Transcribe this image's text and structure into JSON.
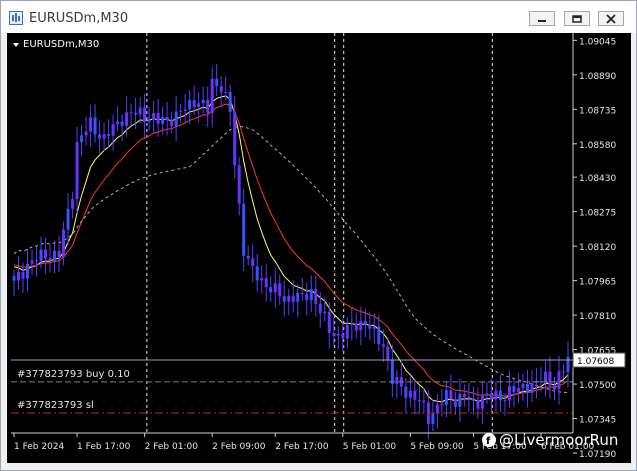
{
  "window": {
    "title": "EURUSDm,M30",
    "buttons": [
      "minimize-icon",
      "restore-icon",
      "close-icon"
    ]
  },
  "chart_header": {
    "label": "EURUSDm,M30"
  },
  "colors": {
    "background": "#000000",
    "candle": "#6633ff",
    "candle_alt": "#3355ff",
    "ema_fast": "#ffff66",
    "ema_mid": "#ff3333",
    "sma_slow": "#b0b0b0",
    "order_line": "#808080",
    "sl_line": "#cc2222",
    "price_tag_bg": "#ffffff"
  },
  "orders": [
    {
      "label": "#377823793 buy 0.10",
      "price": 1.0751,
      "type": "buy"
    },
    {
      "label": "#377823793 sl",
      "price": 1.0737,
      "type": "sl"
    }
  ],
  "current_price": "1.07608",
  "watermark": "@LivermoorRun",
  "chart_data": {
    "type": "candlestick",
    "symbol": "EURUSDm",
    "timeframe": "M30",
    "ylim": [
      1.0728,
      1.0906
    ],
    "y_ticks": [
      "1.09045",
      "1.08890",
      "1.08735",
      "1.08580",
      "1.08430",
      "1.08275",
      "1.08120",
      "1.07965",
      "1.07810",
      "1.07655",
      "1.07500",
      "1.07345",
      "1.07190"
    ],
    "x_ticks": [
      "1 Feb 2024",
      "1 Feb 17:00",
      "2 Feb 01:00",
      "2 Feb 09:00",
      "2 Feb 17:00",
      "5 Feb 01:00",
      "5 Feb 09:00",
      "5 Feb 17:00",
      "6 Feb 01:00"
    ],
    "period_separators": [
      "1 Feb 2024 21:00",
      "2 Feb 2024 19:30",
      "2 Feb 2024 20:30",
      "5 Feb 2024 14:00"
    ],
    "price_path": [
      [
        0,
        1.0795
      ],
      [
        3,
        1.0804
      ],
      [
        7,
        1.0808
      ],
      [
        10,
        1.0808
      ],
      [
        13,
        1.0837
      ],
      [
        14,
        1.0858
      ],
      [
        17,
        1.0867
      ],
      [
        20,
        1.086
      ],
      [
        24,
        1.087
      ],
      [
        28,
        1.0872
      ],
      [
        32,
        1.0868
      ],
      [
        36,
        1.087
      ],
      [
        40,
        1.0878
      ],
      [
        43,
        1.0873
      ],
      [
        44,
        1.0886
      ],
      [
        46,
        1.0884
      ],
      [
        48,
        1.0872
      ],
      [
        49,
        1.0849
      ],
      [
        51,
        1.0811
      ],
      [
        53,
        1.08
      ],
      [
        56,
        1.0795
      ],
      [
        60,
        1.0788
      ],
      [
        62,
        1.079
      ],
      [
        64,
        1.0788
      ],
      [
        66,
        1.0792
      ],
      [
        68,
        1.0783
      ],
      [
        70,
        1.0774
      ],
      [
        72,
        1.0772
      ],
      [
        74,
        1.0774
      ],
      [
        76,
        1.0777
      ],
      [
        78,
        1.0778
      ],
      [
        80,
        1.0772
      ],
      [
        82,
        1.0768
      ],
      [
        84,
        1.0752
      ],
      [
        86,
        1.0748
      ],
      [
        88,
        1.0746
      ],
      [
        90,
        1.0742
      ],
      [
        92,
        1.0735
      ],
      [
        94,
        1.074
      ],
      [
        96,
        1.0744
      ],
      [
        98,
        1.0743
      ],
      [
        100,
        1.0745
      ],
      [
        102,
        1.074
      ],
      [
        104,
        1.0745
      ],
      [
        106,
        1.0744
      ],
      [
        108,
        1.0744
      ],
      [
        110,
        1.0747
      ],
      [
        112,
        1.0747
      ],
      [
        114,
        1.075
      ],
      [
        116,
        1.075
      ],
      [
        118,
        1.0753
      ],
      [
        120,
        1.075
      ],
      [
        122,
        1.0756
      ],
      [
        123,
        1.0761
      ]
    ],
    "indicators": [
      {
        "kind": "ema-fast",
        "color": "#ffff66"
      },
      {
        "kind": "ema-mid",
        "color": "#ff3333"
      },
      {
        "kind": "sma-slow",
        "color": "#b0b0b0",
        "style": "dashed"
      }
    ]
  }
}
